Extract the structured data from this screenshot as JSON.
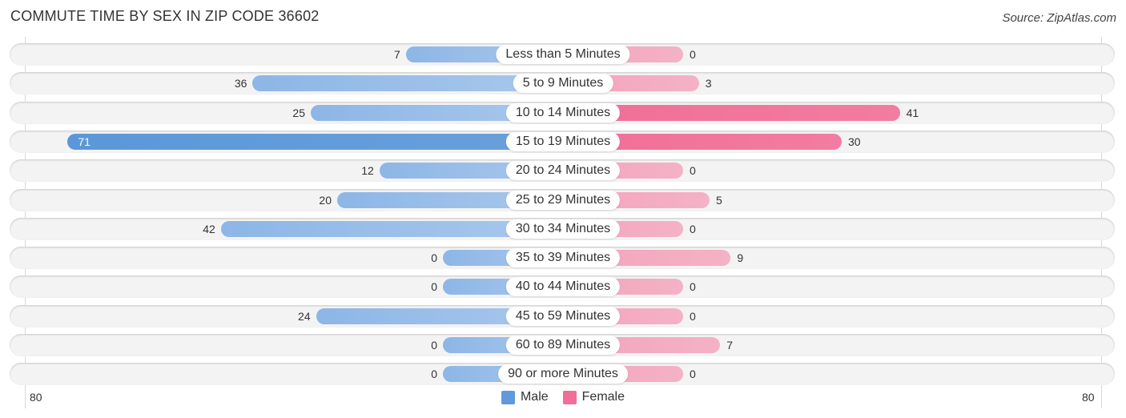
{
  "header": {
    "title": "COMMUTE TIME BY SEX IN ZIP CODE 36602",
    "source": "Source: ZipAtlas.com"
  },
  "colors": {
    "male": "#6199da",
    "female": "#f06e98"
  },
  "chart_data": {
    "type": "bar",
    "orientation": "horizontal-diverging",
    "title": "COMMUTE TIME BY SEX IN ZIP CODE 36602",
    "categories": [
      "Less than 5 Minutes",
      "5 to 9 Minutes",
      "10 to 14 Minutes",
      "15 to 19 Minutes",
      "20 to 24 Minutes",
      "25 to 29 Minutes",
      "30 to 34 Minutes",
      "35 to 39 Minutes",
      "40 to 44 Minutes",
      "45 to 59 Minutes",
      "60 to 89 Minutes",
      "90 or more Minutes"
    ],
    "series": [
      {
        "name": "Male",
        "values": [
          7,
          36,
          25,
          71,
          12,
          20,
          42,
          0,
          0,
          24,
          0,
          0
        ]
      },
      {
        "name": "Female",
        "values": [
          0,
          3,
          41,
          30,
          0,
          5,
          0,
          9,
          0,
          0,
          7,
          0
        ]
      }
    ],
    "axis": {
      "left_tick": "80",
      "right_tick": "80",
      "range": [
        -80,
        80
      ]
    },
    "legend": {
      "position": "bottom-center",
      "entries": [
        "Male",
        "Female"
      ]
    },
    "grid": false
  }
}
